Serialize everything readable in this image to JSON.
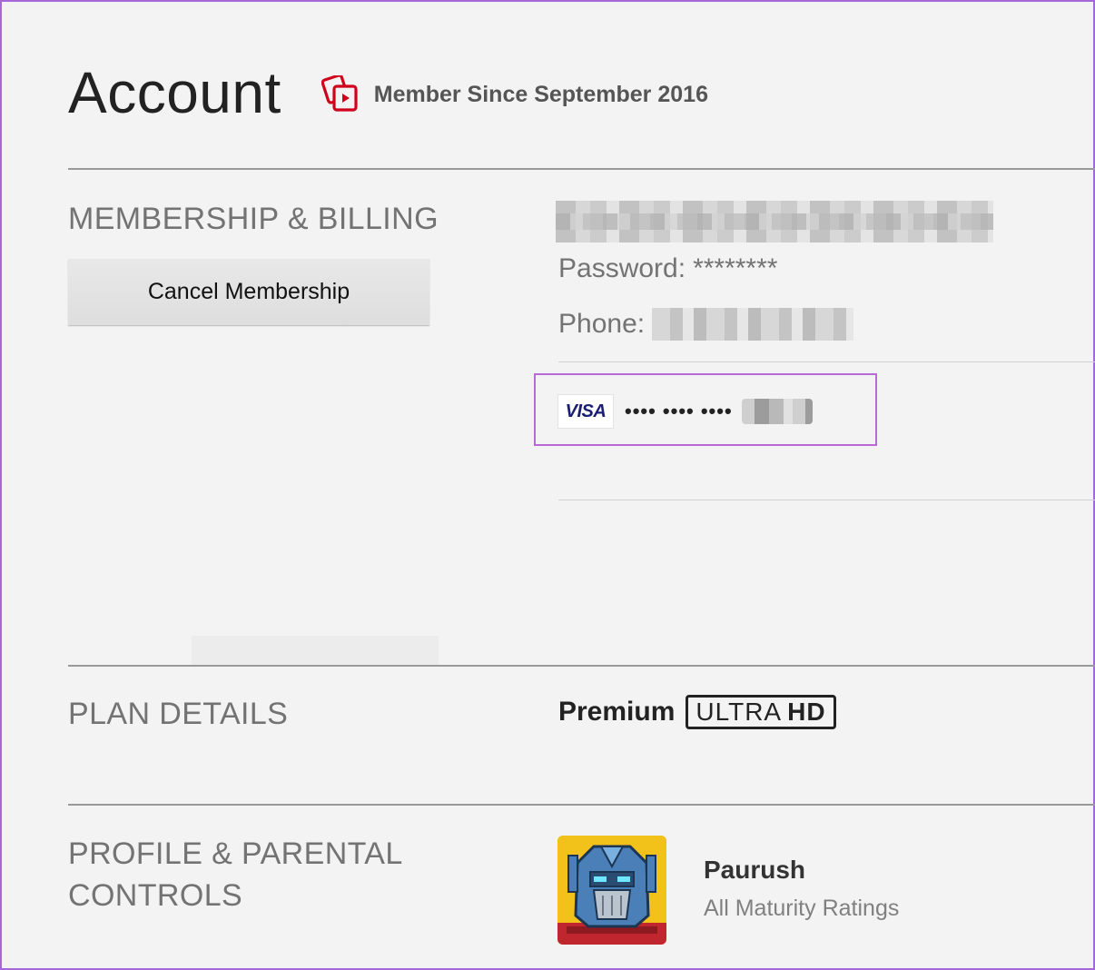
{
  "header": {
    "title": "Account",
    "member_since": "Member Since September 2016",
    "member_since_icon": "membership-cards-icon",
    "accent_color": "#d0021b"
  },
  "membership": {
    "section_title": "MEMBERSHIP & BILLING",
    "cancel_button_label": "Cancel Membership",
    "password_label": "Password:",
    "password_value": "********",
    "phone_label": "Phone:",
    "card": {
      "brand": "VISA",
      "masked_number": "•••• •••• ••••",
      "highlight_color": "#b76ad6"
    }
  },
  "plan": {
    "section_title": "PLAN DETAILS",
    "plan_name": "Premium",
    "badge_light": "ULTRA",
    "badge_bold": "HD"
  },
  "profile": {
    "section_title_line1": "PROFILE & PARENTAL",
    "section_title_line2": "CONTROLS",
    "name": "Paurush",
    "rating": "All Maturity Ratings",
    "avatar_icon": "robot-avatar-icon"
  }
}
